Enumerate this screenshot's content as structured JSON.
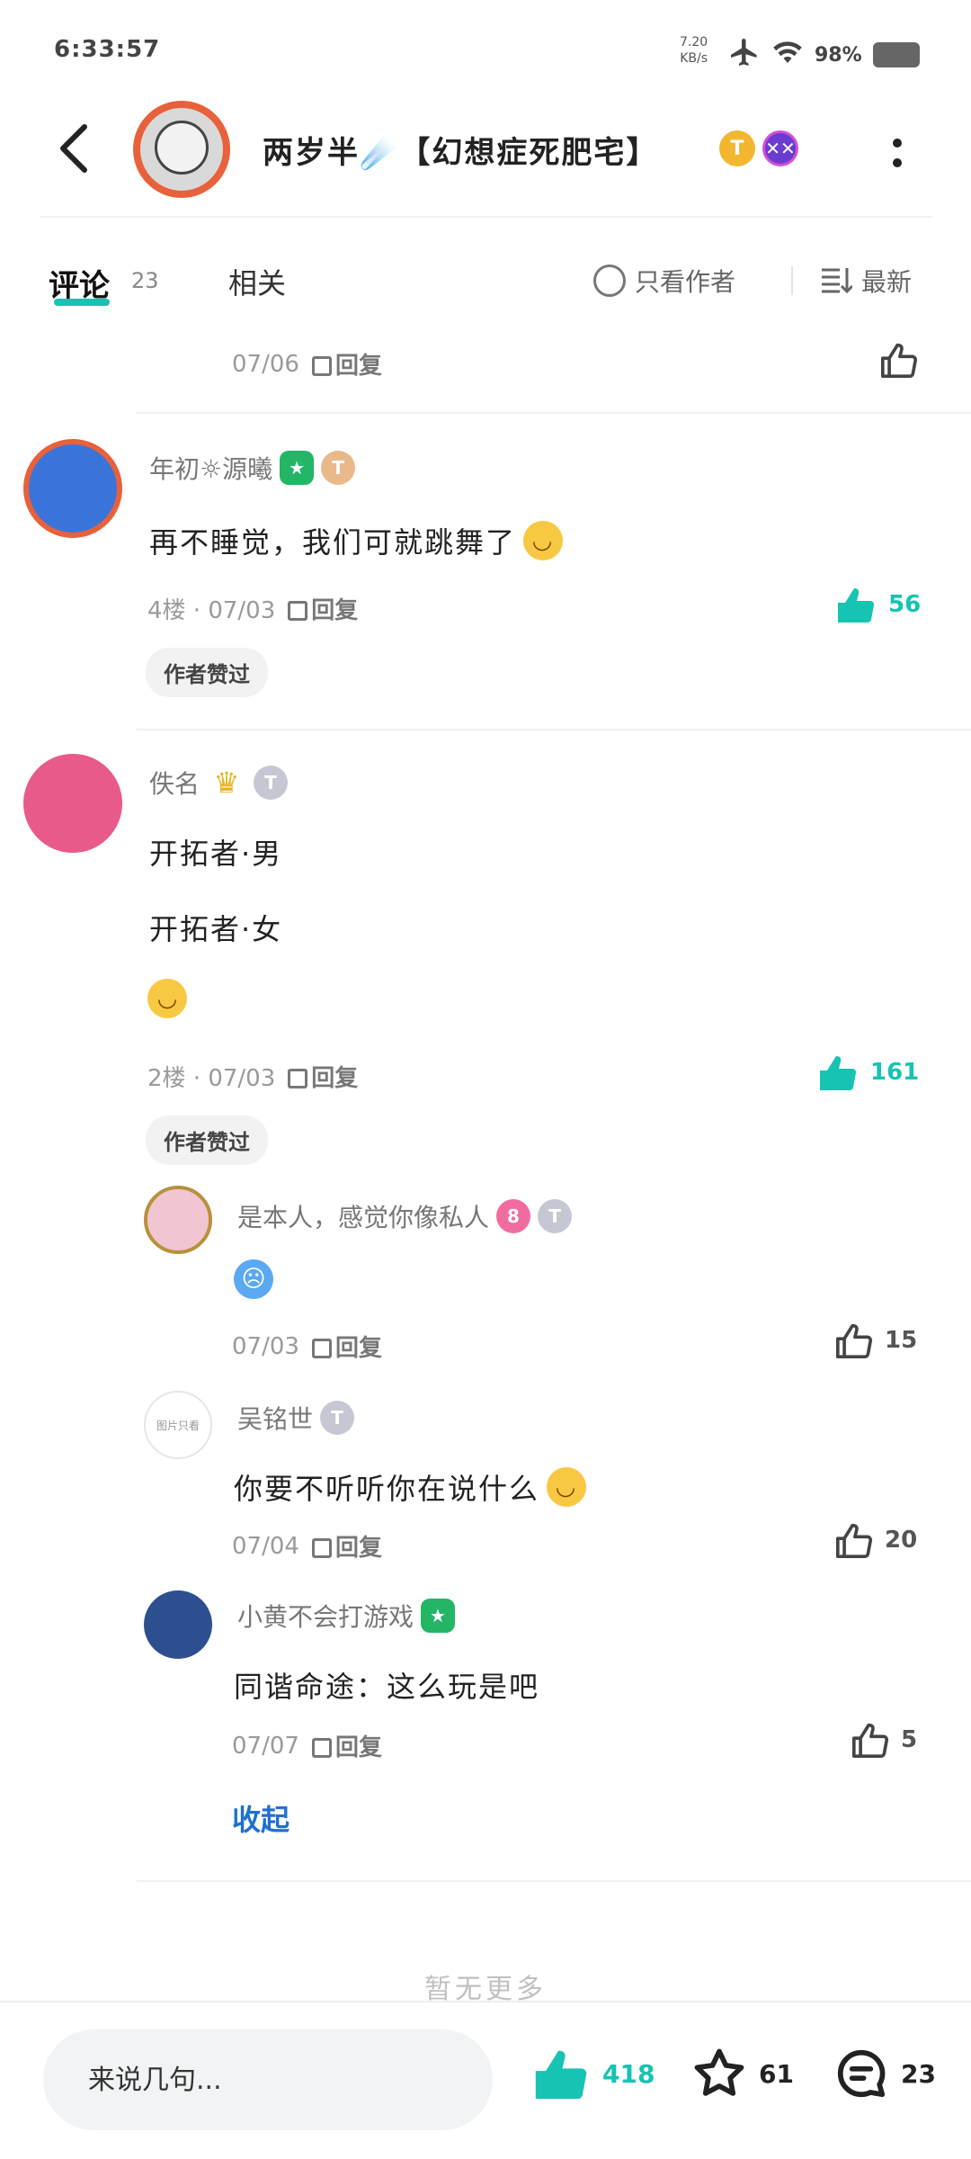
{
  "status_bar": {
    "time": "6:33:57",
    "net_speed_value": "7.20",
    "net_speed_unit": "KB/s",
    "battery": "98%"
  },
  "header": {
    "title": "两岁半☄️【幻想症死肥宅】",
    "coin_badge": "T",
    "skull_badge": "✕✕"
  },
  "tabs": {
    "comments_label": "评论",
    "comments_count": "23",
    "related_label": "相关",
    "author_only_label": "只看作者",
    "sort_label": "最新"
  },
  "top_partial": {
    "date": "07/06",
    "reply": "回复"
  },
  "comments": [
    {
      "username": "年初☼源曦",
      "badge_level": "T",
      "text": "再不睡觉，我们可就跳舞了",
      "floor_meta": "4楼 · 07/03",
      "reply": "回复",
      "likes": "56",
      "author_liked": "作者赞过"
    },
    {
      "username": "佚名",
      "badge_level": "T",
      "lines": [
        "开拓者·男",
        "开拓者·女"
      ],
      "floor_meta": "2楼 · 07/03",
      "reply": "回复",
      "likes": "161",
      "author_liked": "作者赞过"
    }
  ],
  "replies": [
    {
      "username": "是本人，感觉你像私人",
      "badge_num": "8",
      "badge_level": "T",
      "date": "07/03",
      "reply": "回复",
      "likes": "15"
    },
    {
      "username": "吴铭世",
      "badge_level": "T",
      "text": "你要不听听你在说什么",
      "date": "07/04",
      "reply": "回复",
      "likes": "20",
      "avatar_text": "图片只看"
    },
    {
      "username": "小黄不会打游戏",
      "text": "同谐命途：这么玩是吧",
      "date": "07/07",
      "reply": "回复",
      "likes": "5"
    }
  ],
  "collapse_label": "收起",
  "no_more_label": "暂无更多",
  "bottom_bar": {
    "input_placeholder": "来说几句...",
    "likes": "418",
    "favorites": "61",
    "comments": "23"
  },
  "colors": {
    "accent_teal": "#17c3b2",
    "link_blue": "#1f6fd1",
    "avatar_ring": "#e8613a"
  }
}
